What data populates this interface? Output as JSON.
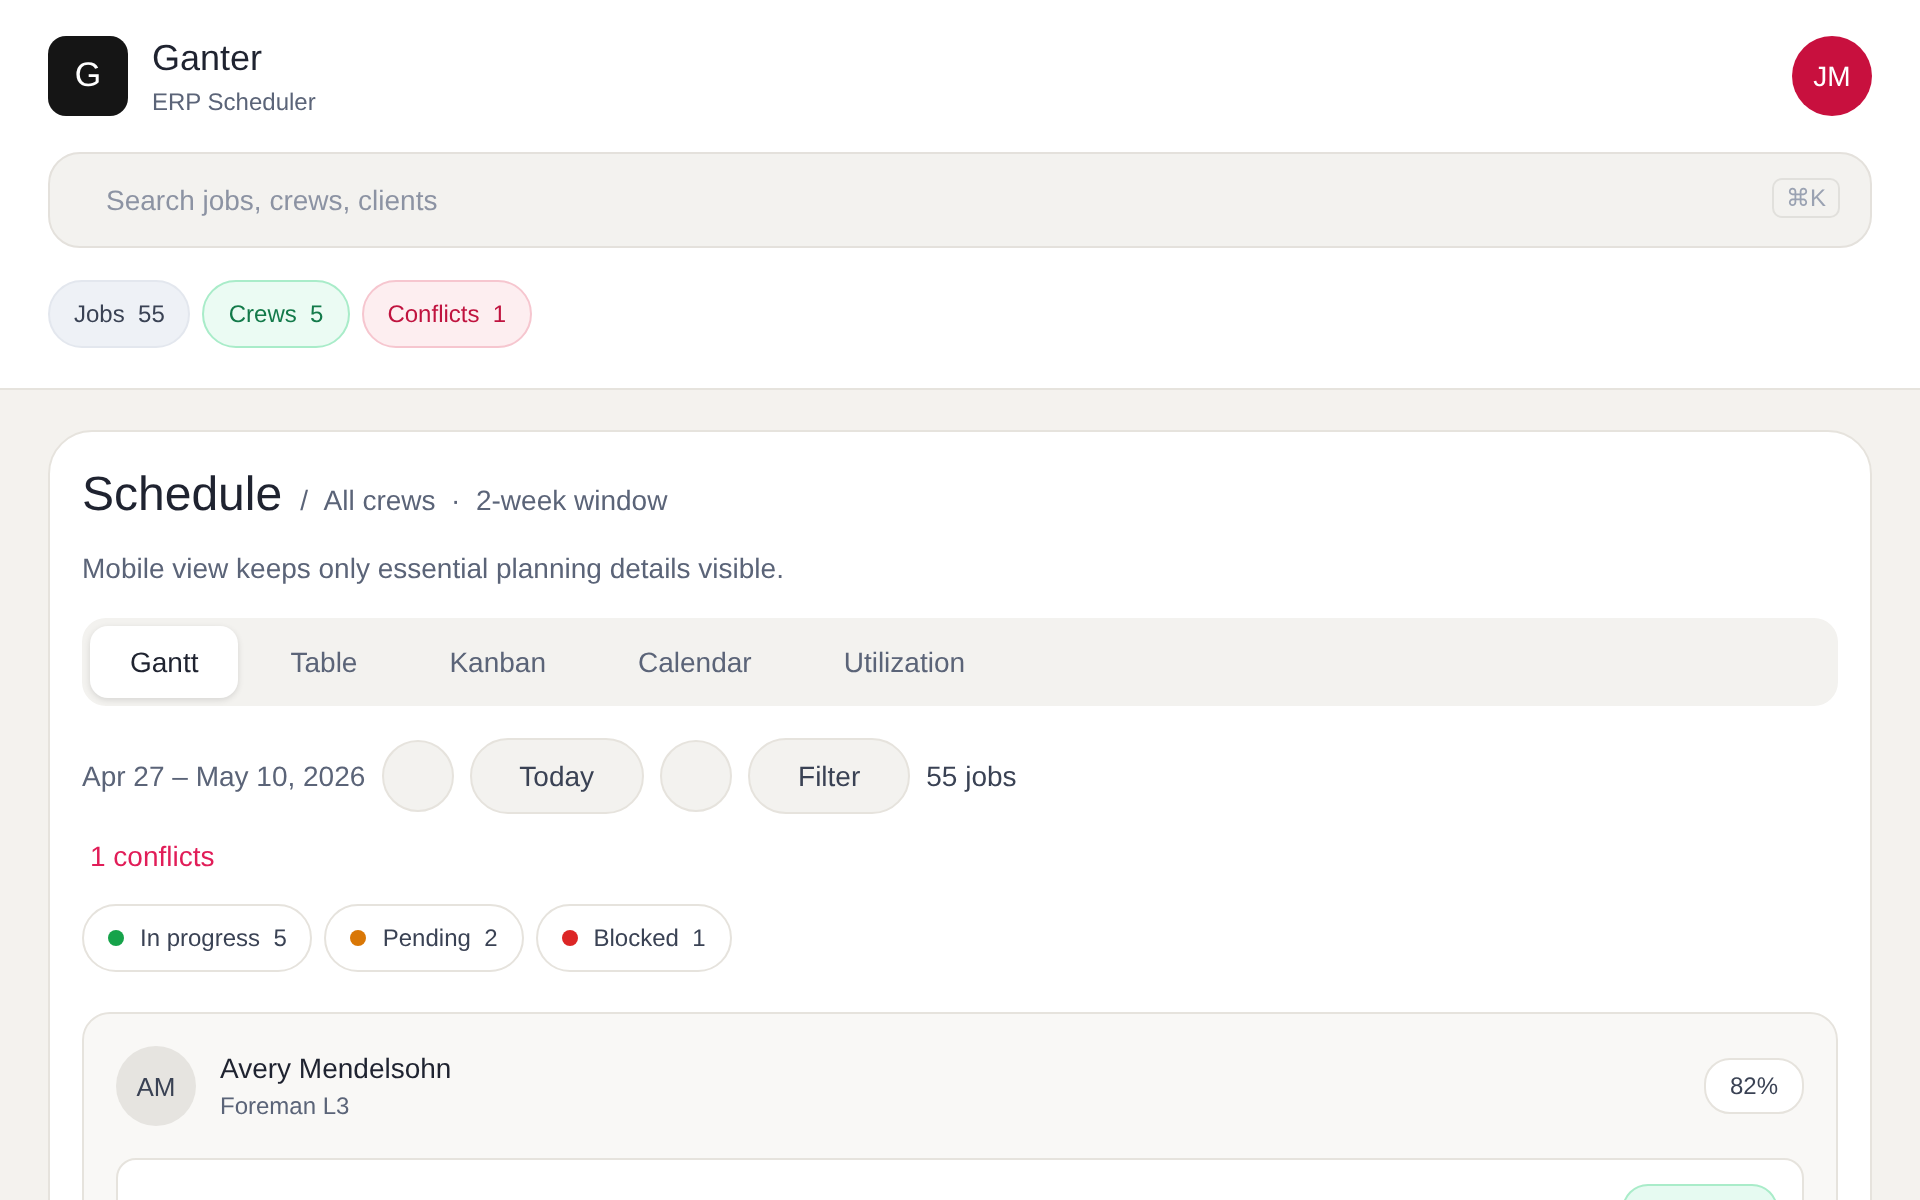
{
  "app": {
    "logo": "G",
    "name": "Ganter",
    "subtitle": "ERP Scheduler",
    "avatar": "JM"
  },
  "search": {
    "placeholder": "Search jobs, crews, clients",
    "shortcut": "⌘K"
  },
  "summary_chips": [
    {
      "label": "Jobs",
      "count": "55",
      "kind": "neutral"
    },
    {
      "label": "Crews",
      "count": "5",
      "kind": "success"
    },
    {
      "label": "Conflicts",
      "count": "1",
      "kind": "danger"
    }
  ],
  "schedule": {
    "title": "Schedule",
    "separator": "/",
    "scope": "All crews",
    "dot": "·",
    "window": "2-week window",
    "description": "Mobile view keeps only essential planning details visible."
  },
  "tabs": [
    {
      "label": "Gantt",
      "selected": true
    },
    {
      "label": "Table",
      "selected": false
    },
    {
      "label": "Kanban",
      "selected": false
    },
    {
      "label": "Calendar",
      "selected": false
    },
    {
      "label": "Utilization",
      "selected": false
    }
  ],
  "toolbar": {
    "date_range": "Apr 27 – May 10, 2026",
    "today": "Today",
    "filter": "Filter",
    "job_count": "55 jobs"
  },
  "conflicts": "1 conflicts",
  "status_chips": [
    {
      "label": "In progress",
      "count": "5",
      "color": "#16a34a"
    },
    {
      "label": "Pending",
      "count": "2",
      "color": "#d97706"
    },
    {
      "label": "Blocked",
      "count": "1",
      "color": "#dc2626"
    }
  ],
  "crew": {
    "initials": "AM",
    "name": "Avery Mendelsohn",
    "role": "Foreman L3",
    "utilization": "82%"
  }
}
